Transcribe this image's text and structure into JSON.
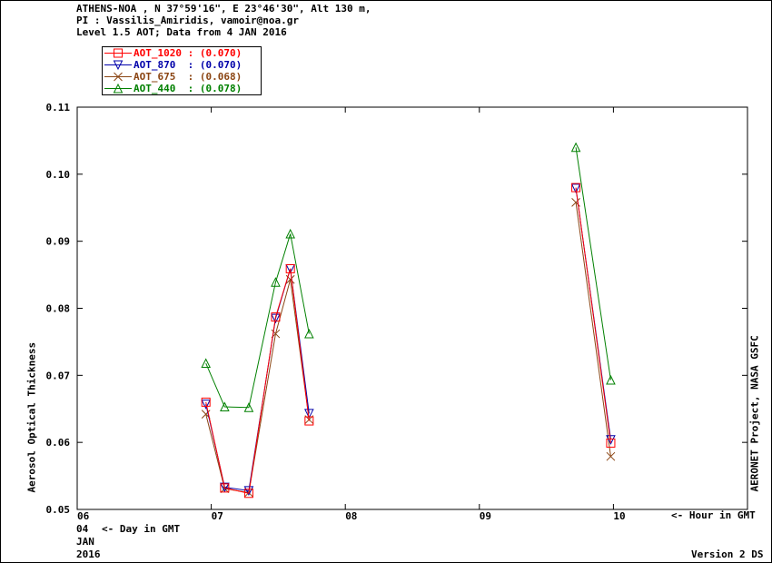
{
  "header": {
    "line1": "ATHENS-NOA , N 37°59'16\", E 23°46'30\", Alt 130 m,",
    "line2": "PI : Vassilis_Amiridis, vamoir@noa.gr",
    "line3": "Level 1.5 AOT; Data from 4 JAN 2016"
  },
  "footer": {
    "day": "04",
    "day_label": "<- Day in GMT",
    "month": "JAN",
    "year": "2016",
    "hour_label": "<- Hour in GMT",
    "version": "Version 2 DS",
    "right_label": "AERONET Project, NASA GSFC"
  },
  "chart_data": {
    "type": "line",
    "ylabel": "Aerosol Optical Thickness",
    "xlim": [
      6,
      11
    ],
    "ylim": [
      0.05,
      0.11
    ],
    "x_ticks": [
      {
        "v": 6,
        "label": "06"
      },
      {
        "v": 7,
        "label": "07"
      },
      {
        "v": 8,
        "label": "08"
      },
      {
        "v": 9,
        "label": "09"
      },
      {
        "v": 10,
        "label": "10"
      }
    ],
    "y_ticks": [
      {
        "v": 0.05,
        "label": "0.05"
      },
      {
        "v": 0.06,
        "label": "0.06"
      },
      {
        "v": 0.07,
        "label": "0.07"
      },
      {
        "v": 0.08,
        "label": "0.08"
      },
      {
        "v": 0.09,
        "label": "0.09"
      },
      {
        "v": 0.1,
        "label": "0.10"
      },
      {
        "v": 0.11,
        "label": "0.11"
      }
    ],
    "series": [
      {
        "name": "AOT_1020",
        "mean": "(0.070)",
        "color": "#ff0000",
        "marker": "square",
        "points": [
          [
            6.96,
            0.066
          ],
          [
            7.1,
            0.0532
          ],
          [
            7.28,
            0.0524
          ],
          [
            7.48,
            0.0787
          ],
          [
            7.59,
            0.0859
          ],
          [
            7.73,
            0.0632
          ],
          [
            9.72,
            0.098
          ],
          [
            9.98,
            0.0599
          ]
        ]
      },
      {
        "name": "AOT_870",
        "mean": "(0.070)",
        "color": "#0000aa",
        "marker": "triangle-down",
        "points": [
          [
            6.96,
            0.0657
          ],
          [
            7.1,
            0.0533
          ],
          [
            7.28,
            0.0528
          ],
          [
            7.48,
            0.0785
          ],
          [
            7.59,
            0.0859
          ],
          [
            7.73,
            0.0643
          ],
          [
            9.72,
            0.0979
          ],
          [
            9.98,
            0.0604
          ]
        ]
      },
      {
        "name": "AOT_675",
        "mean": "(0.068)",
        "color": "#8b4513",
        "marker": "x",
        "points": [
          [
            6.96,
            0.0642
          ],
          [
            7.1,
            0.0531
          ],
          [
            7.28,
            0.0525
          ],
          [
            7.48,
            0.0762
          ],
          [
            7.59,
            0.0843
          ],
          [
            7.73,
            0.0634
          ],
          [
            9.72,
            0.0958
          ],
          [
            9.98,
            0.0579
          ]
        ]
      },
      {
        "name": "AOT_440",
        "mean": "(0.078)",
        "color": "#008000",
        "marker": "triangle-up",
        "points": [
          [
            6.96,
            0.0718
          ],
          [
            7.1,
            0.0653
          ],
          [
            7.28,
            0.0652
          ],
          [
            7.48,
            0.0839
          ],
          [
            7.59,
            0.0911
          ],
          [
            7.73,
            0.0762
          ],
          [
            9.72,
            0.104
          ],
          [
            9.98,
            0.0693
          ]
        ]
      }
    ]
  }
}
